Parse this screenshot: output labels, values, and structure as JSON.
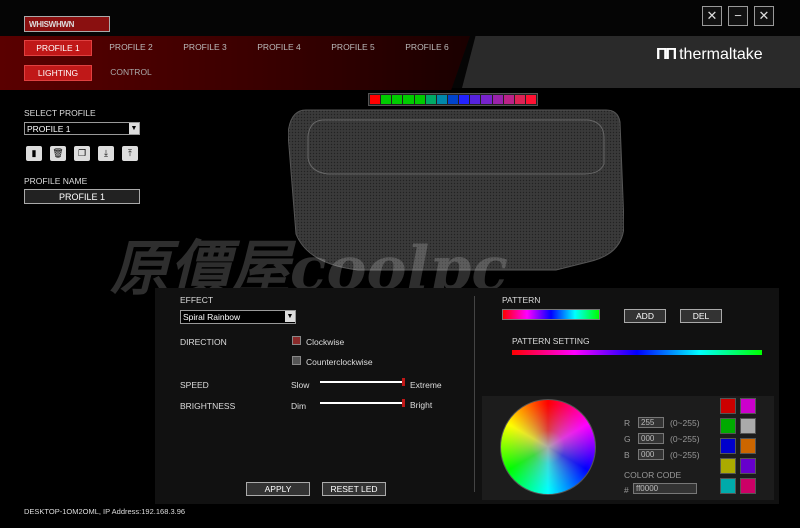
{
  "window": {
    "title_box": "WHISWHWN",
    "buttons": [
      "settings",
      "minimize",
      "close"
    ]
  },
  "brand": {
    "name": "thermaltake"
  },
  "profile_tabs": [
    "PROFILE 1",
    "PROFILE 2",
    "PROFILE 3",
    "PROFILE 4",
    "PROFILE 5",
    "PROFILE 6"
  ],
  "active_profile_tab": 0,
  "sub_tabs": [
    "LIGHTING",
    "CONTROL"
  ],
  "active_sub_tab": 0,
  "left": {
    "select_profile_label": "SELECT PROFILE",
    "select_profile_value": "PROFILE 1",
    "icon_buttons": [
      "save-icon",
      "delete-icon",
      "copy-icon",
      "import-icon",
      "export-icon"
    ],
    "profile_name_label": "PROFILE NAME",
    "profile_name_value": "PROFILE 1"
  },
  "led_strip_colors": [
    "#ff0000",
    "#00cc00",
    "#00cc00",
    "#00cc00",
    "#00cc00",
    "#00aa66",
    "#0088aa",
    "#0044cc",
    "#2222ff",
    "#5522dd",
    "#7722cc",
    "#9922aa",
    "#bb2288",
    "#dd2255",
    "#ff1133"
  ],
  "effect": {
    "label": "EFFECT",
    "value": "Spiral Rainbow",
    "direction_label": "DIRECTION",
    "direction_options": [
      "Clockwise",
      "Counterclockwise"
    ],
    "direction_selected": 0,
    "speed_label": "SPEED",
    "speed_min": "Slow",
    "speed_max": "Extreme",
    "speed_level": 1.0,
    "brightness_label": "BRIGHTNESS",
    "brightness_min": "Dim",
    "brightness_max": "Bright",
    "brightness_level": 1.0,
    "apply_label": "APPLY",
    "reset_label": "RESET LED"
  },
  "pattern": {
    "label": "PATTERN",
    "add_label": "ADD",
    "del_label": "DEL",
    "setting_label": "PATTERN SETTING"
  },
  "color": {
    "r_label": "R",
    "r_value": "255",
    "r_range": "(0~255)",
    "g_label": "G",
    "g_value": "000",
    "g_range": "(0~255)",
    "b_label": "B",
    "b_value": "000",
    "b_range": "(0~255)",
    "code_label": "COLOR CODE",
    "hash": "#",
    "code_value": "ff0000",
    "swatches": [
      "#cc0000",
      "#cc00cc",
      "#00aa00",
      "#aaaaaa",
      "#0000cc",
      "#cc6600",
      "#aaaa00",
      "#6600cc",
      "#00aaaa",
      "#cc0066"
    ]
  },
  "status": {
    "text": "DESKTOP-1OM2OML, IP Address:192.168.3.96"
  },
  "watermark": "原價屋coolpc"
}
